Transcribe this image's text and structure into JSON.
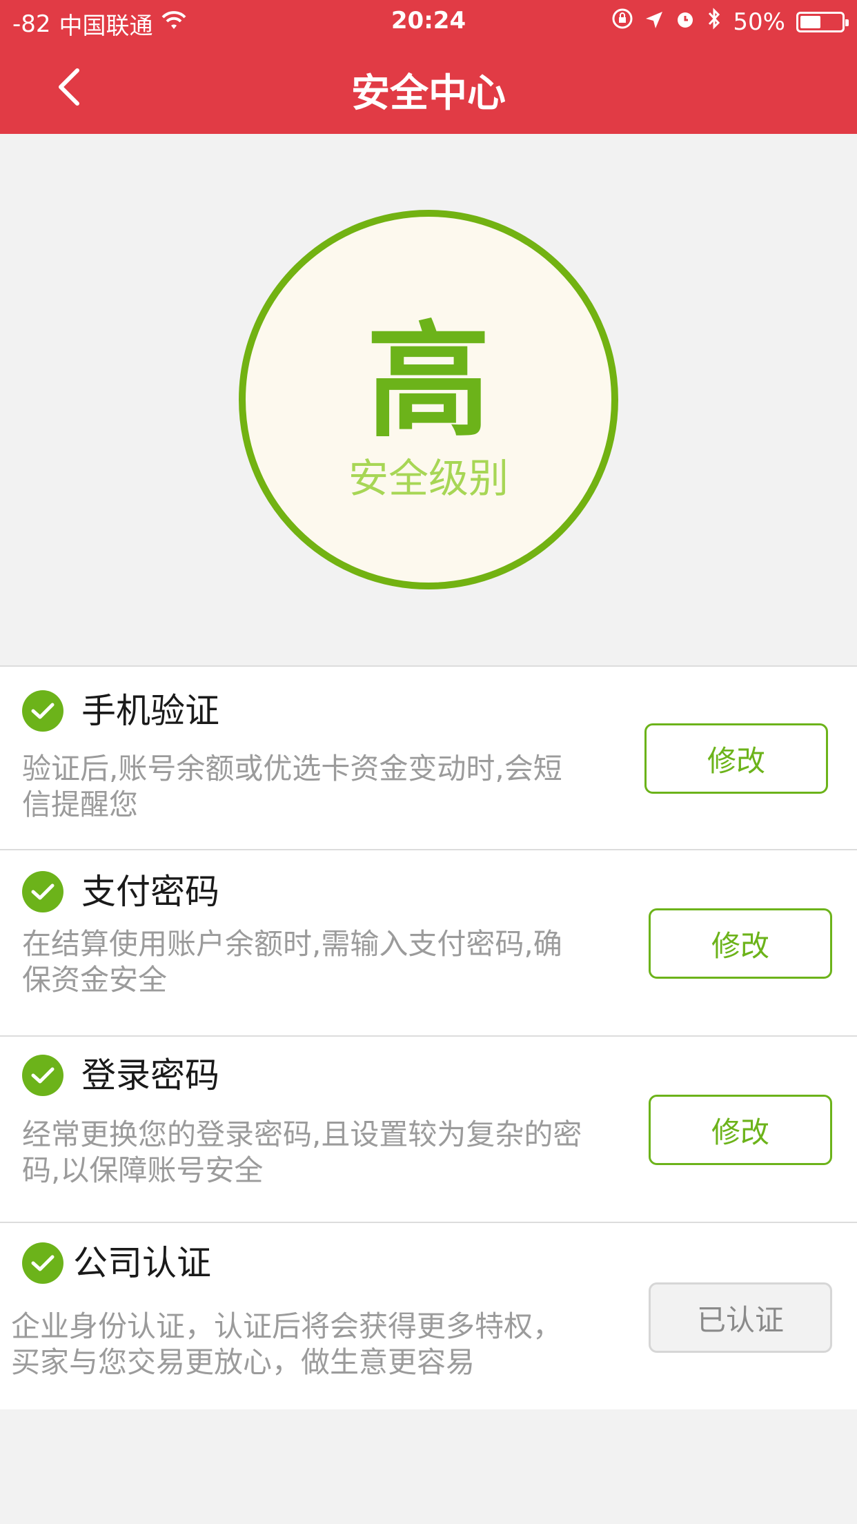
{
  "status_bar": {
    "signal": "-82",
    "carrier": "中国联通",
    "time": "20:24",
    "battery_text": "50%",
    "battery_level": 0.5
  },
  "header": {
    "title": "安全中心",
    "background_color": "#e13b45"
  },
  "security_level": {
    "value": "高",
    "label": "安全级别",
    "accent_color": "#6cb31a"
  },
  "items": [
    {
      "title": "手机验证",
      "desc_line1": "验证后,账号余额或优选卡资金变动时,会短",
      "desc_line2": "信提醒您",
      "button": "修改"
    },
    {
      "title": "支付密码",
      "desc_line1": "在结算使用账户余额时,需输入支付密码,确",
      "desc_line2": "保资金安全",
      "button": "修改"
    },
    {
      "title": "登录密码",
      "desc_line1": "经常更换您的登录密码,且设置较为复杂的密",
      "desc_line2": "码,以保障账号安全",
      "button": "修改"
    },
    {
      "title": "公司认证",
      "desc_line1": "企业身份认证，认证后将会获得更多特权，",
      "desc_line2": "买家与您交易更放心，做生意更容易",
      "button": "已认证"
    }
  ]
}
